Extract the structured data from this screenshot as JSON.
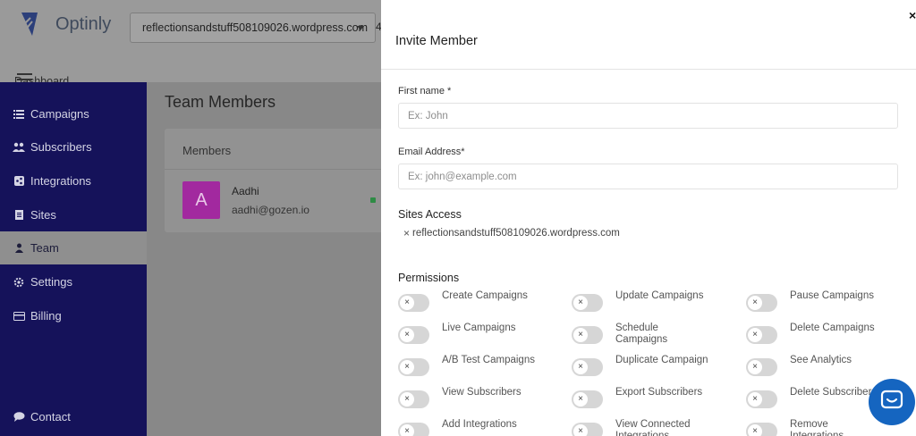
{
  "app": {
    "brand": "Optinly",
    "site_selector": "reflectionsandstuff508109026.wordpress.com",
    "truncated_text": "4"
  },
  "sidebar": {
    "peek_label": "Dashboard",
    "items": [
      {
        "label": "Campaigns",
        "icon": "list-icon"
      },
      {
        "label": "Subscribers",
        "icon": "users-icon"
      },
      {
        "label": "Integrations",
        "icon": "share-icon"
      },
      {
        "label": "Sites",
        "icon": "document-icon"
      },
      {
        "label": "Team",
        "icon": "user-icon",
        "active": true
      },
      {
        "label": "Settings",
        "icon": "gear-icon"
      },
      {
        "label": "Billing",
        "icon": "credit-card-icon"
      }
    ],
    "contact": {
      "label": "Contact",
      "icon": "chat-bubble-icon"
    }
  },
  "main": {
    "title": "Team Members",
    "members_header": "Members",
    "members": [
      {
        "initial": "A",
        "name": "Aadhi",
        "email": "aadhi@gozen.io"
      }
    ]
  },
  "modal": {
    "close": "×",
    "title": "Invite Member",
    "first_name": {
      "label": "First name *",
      "placeholder": "Ex: John",
      "value": ""
    },
    "email": {
      "label": "Email Address*",
      "placeholder": "Ex: john@example.com",
      "value": ""
    },
    "sites_access_label": "Sites Access",
    "selected_site": "reflectionsandstuff508109026.wordpress.com",
    "chip_remove": "×",
    "permissions_label": "Permissions",
    "permissions": [
      {
        "label": "Create Campaigns",
        "enabled": false
      },
      {
        "label": "Update Campaigns",
        "enabled": false
      },
      {
        "label": "Pause Campaigns",
        "enabled": false
      },
      {
        "label": "Live Campaigns",
        "enabled": false
      },
      {
        "label": "Schedule Campaigns",
        "enabled": false
      },
      {
        "label": "Delete Campaigns",
        "enabled": false
      },
      {
        "label": "A/B Test Campaigns",
        "enabled": false
      },
      {
        "label": "Duplicate Campaign",
        "enabled": false
      },
      {
        "label": "See Analytics",
        "enabled": false
      },
      {
        "label": "View Subscribers",
        "enabled": false
      },
      {
        "label": "Export Subscribers",
        "enabled": false
      },
      {
        "label": "Delete Subscribers",
        "enabled": false
      },
      {
        "label": "Add Integrations",
        "enabled": false
      },
      {
        "label": "View Connected Integrations",
        "enabled": false
      },
      {
        "label": "Remove Integrations",
        "enabled": false
      }
    ],
    "toggle_off_symbol": "×"
  },
  "colors": {
    "sidebar": "#15125a",
    "avatar": "#a2299f",
    "chat_button": "#1565c0",
    "status_online": "#2e8b45"
  }
}
